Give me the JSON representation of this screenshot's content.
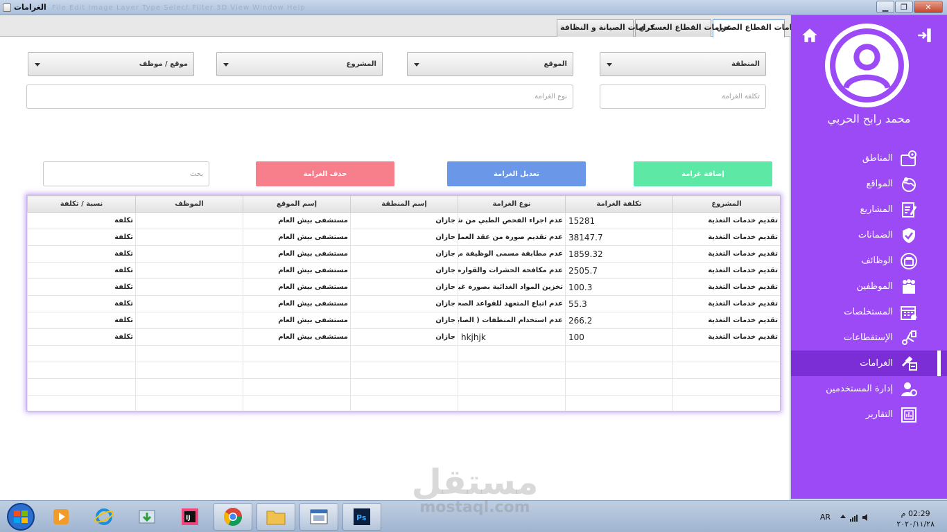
{
  "window": {
    "title": "الغرامات",
    "ghost_menu": "File    Edit    Image    Layer    Type    Select    Filter    3D    View    Window    Help"
  },
  "tabs": [
    {
      "label": "غرامات القطاع الصحي",
      "active": true
    },
    {
      "label": "غرامات القطاع العسكري",
      "active": false
    },
    {
      "label": "غرامات الصيانة و النظافة",
      "active": false
    }
  ],
  "filters": {
    "region": "المنطقة",
    "site": "الموقع",
    "project": "المشروع",
    "site_employee": "موقع / موظف"
  },
  "inputs": {
    "fine_cost_placeholder": "تكلفة الغرامة",
    "fine_type_placeholder": "نوع الغرامة",
    "search_placeholder": "بحث"
  },
  "buttons": {
    "add": "إضافة غرامة",
    "edit": "تعديل الغرامة",
    "delete": "حذف الغرامة"
  },
  "colors": {
    "sidebar": "#9b4af5",
    "add": "#5de8a6",
    "edit": "#6a97e8",
    "delete": "#f77f8b"
  },
  "table": {
    "headers": [
      "المشروع",
      "تكلفة الغرامة",
      "نوع الغرامة",
      "إسم المنطقة",
      "إسم الموقع",
      "الموظف",
      "نسبة / تكلفة"
    ],
    "rows": [
      [
        "تقديم خدمات التغذية",
        "15281",
        "عدم اجراء الفحص الطبي من شهر ...",
        "جازان",
        "مستشفى بيش العام",
        "",
        "تكلفة"
      ],
      [
        "تقديم خدمات التغذية",
        "38147.7",
        "عدم تقديم صورة من عقد العمل بين ا...",
        "جازان",
        "مستشفى بيش العام",
        "",
        "تكلفة"
      ],
      [
        "تقديم خدمات التغذية",
        "1859.32",
        "عدم مطابقة مسمى الوظيفة مع المهن...",
        "جازان",
        "مستشفى بيش العام",
        "",
        "تكلفة"
      ],
      [
        "تقديم خدمات التغذية",
        "2505.7",
        "عدم مكافحة الحشرات والقوارض( ...",
        "جازان",
        "مستشفى بيش العام",
        "",
        "تكلفة"
      ],
      [
        "تقديم خدمات التغذية",
        "100.3",
        "تخزين المواد الغذائية بصورة غير ج...",
        "جازان",
        "مستشفى بيش العام",
        "",
        "تكلفة"
      ],
      [
        "تقديم خدمات التغذية",
        "55.3",
        "عدم اتباع المتعهد للقواعد الصحية لإ...",
        "جازان",
        "مستشفى بيش العام",
        "",
        "تكلفة"
      ],
      [
        "تقديم خدمات التغذية",
        "266.2",
        "عدم استخدام المنظفات ( الصابون ...",
        "جازان",
        "مستشفى بيش العام",
        "",
        "تكلفة"
      ],
      [
        "تقديم خدمات التغذية",
        "100",
        "hkjhjk",
        "جازان",
        "مستشفى بيش العام",
        "",
        "تكلفة"
      ]
    ],
    "empty_rows": 4
  },
  "sidebar": {
    "user_name": "محمد رابح الحربي",
    "items": [
      {
        "label": "المناطق",
        "icon": "map-pin-icon",
        "active": false
      },
      {
        "label": "المواقع",
        "icon": "globe-icon",
        "active": false
      },
      {
        "label": "المشاريع",
        "icon": "clipboard-icon",
        "active": false
      },
      {
        "label": "الضمانات",
        "icon": "shield-check-icon",
        "active": false
      },
      {
        "label": "الوظائف",
        "icon": "briefcase-icon",
        "active": false
      },
      {
        "label": "الموظفين",
        "icon": "people-icon",
        "active": false
      },
      {
        "label": "المستخلصات",
        "icon": "calendar-icon",
        "active": false
      },
      {
        "label": "الإستقطاعات",
        "icon": "scissors-icon",
        "active": false
      },
      {
        "label": "الغرامات",
        "icon": "gavel-icon",
        "active": true
      },
      {
        "label": "إدارة المستخدمين",
        "icon": "user-settings-icon",
        "active": false
      },
      {
        "label": "التقارير",
        "icon": "report-icon",
        "active": false
      }
    ]
  },
  "taskbar": {
    "lang": "AR",
    "time": "02:29 م",
    "date": "٢٠٢٠/١١/٢٨"
  },
  "watermark": {
    "ar": "مستقل",
    "en": "mostaql.com"
  }
}
